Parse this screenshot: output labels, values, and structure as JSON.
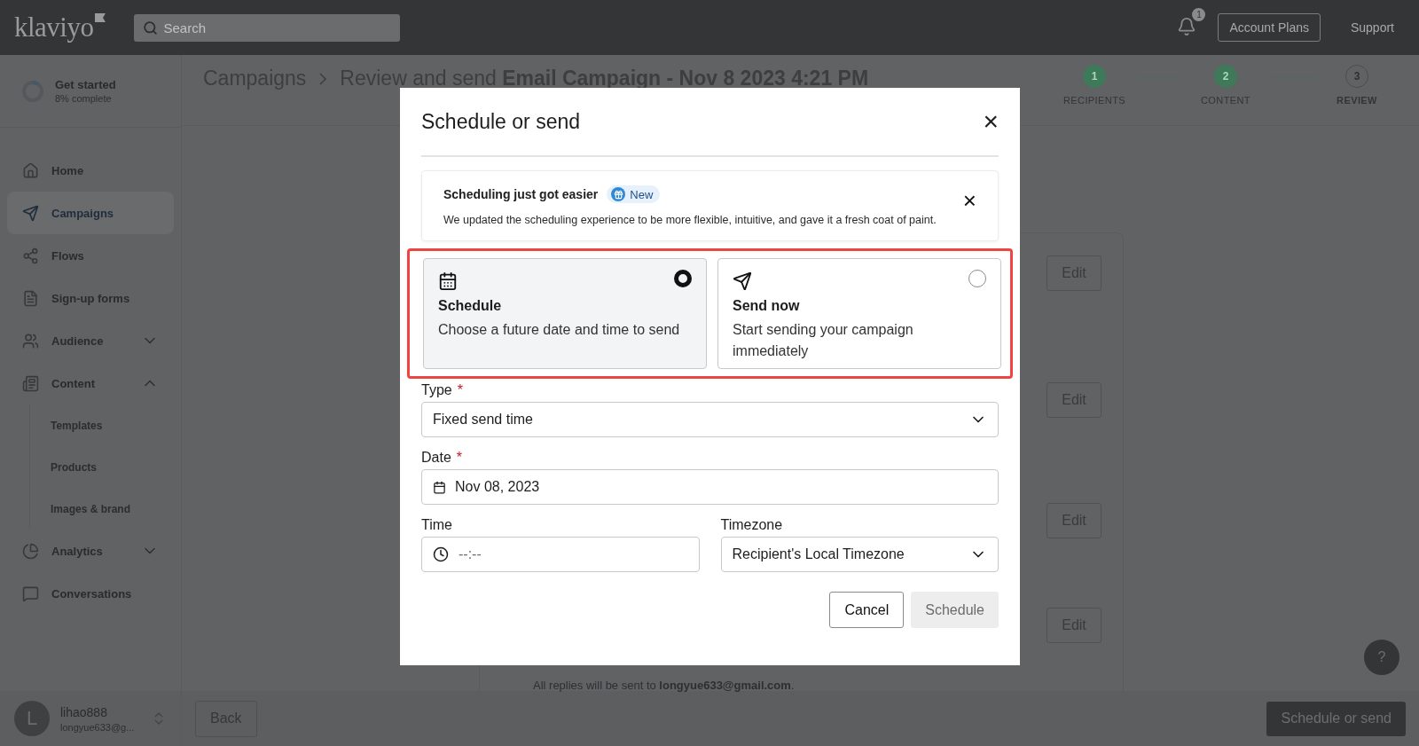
{
  "header": {
    "logo": "klaviyo",
    "search": {
      "placeholder": "Search"
    },
    "notifications": "1",
    "buttons": [
      {
        "label": "Account Plans",
        "kind": "outlined"
      },
      {
        "label": "Support",
        "kind": "plain"
      }
    ]
  },
  "sidebar": {
    "progress": {
      "title": "Get started",
      "subtitle": "8% complete",
      "level": 0.08
    },
    "items": [
      {
        "label": "Home",
        "kind": "link",
        "selected": false
      },
      {
        "label": "Campaigns",
        "kind": "link",
        "selected": true
      },
      {
        "label": "Flows",
        "kind": "link",
        "selected": false
      },
      {
        "label": "Sign-up forms",
        "kind": "link",
        "selected": false
      },
      {
        "label": "Audience",
        "kind": "group",
        "selected": false,
        "expanded": false
      },
      {
        "label": "Content",
        "kind": "group",
        "selected": false,
        "expanded": true,
        "children": [
          {
            "label": "Templates",
            "selected": false
          },
          {
            "label": "Products",
            "selected": false
          },
          {
            "label": "Images & brand",
            "selected": false
          }
        ]
      },
      {
        "label": "Analytics",
        "kind": "group",
        "selected": false,
        "expanded": false
      },
      {
        "label": "Conversations",
        "kind": "link",
        "selected": false
      }
    ],
    "user": {
      "initial": "L",
      "name": "lihao888",
      "email": "longyue633@g..."
    }
  },
  "page": {
    "breadcrumb": "Campaigns",
    "title": "Review and send **Email Campaign - Nov 8 2023 4:21 PM**",
    "steps": [
      {
        "number": "1",
        "label": "RECIPIENTS",
        "done": true,
        "selected": false
      },
      {
        "number": "2",
        "label": "CONTENT",
        "done": true,
        "selected": false
      },
      {
        "number": "3",
        "label": "REVIEW",
        "done": false,
        "selected": true
      }
    ],
    "edit_buttons": [
      "Edit",
      "Edit",
      "Edit",
      "Edit"
    ],
    "replies_note": "All replies will be sent to **longyue633@gmail.com**.",
    "back_button": "Back",
    "primary_button": "Schedule or send",
    "help": "?"
  },
  "modal": {
    "title": "Schedule or send",
    "close": "×",
    "banner": {
      "title": "Scheduling just got easier",
      "badge": "New",
      "text": "We updated the scheduling experience to be more flexible, intuitive, and gave it a fresh coat of paint."
    },
    "options_highlighted": true,
    "options": [
      {
        "kind": "schedule",
        "title": "Schedule",
        "description": "Choose a future date and time to send",
        "selected": true
      },
      {
        "kind": "send",
        "title": "Send now",
        "description": "Start sending your campaign immediately",
        "selected": false
      }
    ],
    "type": {
      "label": "Type",
      "required_mark": "*",
      "value": "Fixed send time"
    },
    "date": {
      "label": "Date",
      "required_mark": "*",
      "value": "Nov 08, 2023"
    },
    "time": {
      "label": "Time",
      "placeholder": "--:--"
    },
    "timezone": {
      "label": "Timezone",
      "value": "Recipient's Local Timezone"
    },
    "buttons": [
      {
        "label": "Cancel",
        "kind": "secondary"
      },
      {
        "label": "Schedule",
        "kind": "disabled"
      }
    ]
  }
}
